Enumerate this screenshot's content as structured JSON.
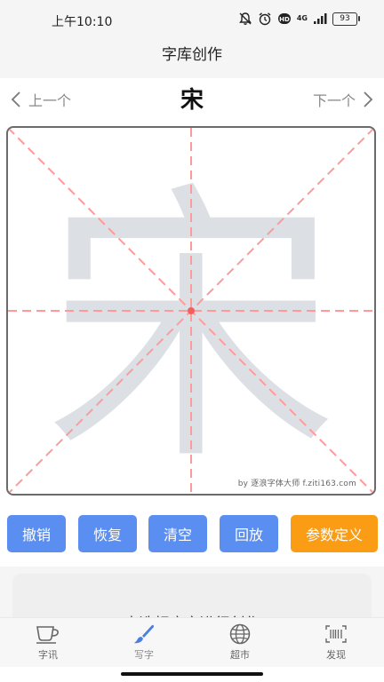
{
  "status": {
    "time": "上午10:10",
    "battery": "93",
    "network": "4G"
  },
  "app": {
    "title": "字库创作"
  },
  "nav": {
    "prev_label": "上一个",
    "next_label": "下一个",
    "current_char": "宋"
  },
  "canvas": {
    "guide_char": "宋",
    "watermark": "by 逐浪字体大师 f.ziti163.com",
    "guide_color": "#ff9a9a"
  },
  "toolbar": {
    "undo": "撤销",
    "redo": "恢复",
    "clear": "清空",
    "playback": "回放",
    "params": "参数定义",
    "colors": {
      "button": "#5a8ef0",
      "primary": "#fa9d14"
    }
  },
  "panel": {
    "text": "点选相应字进行创作"
  },
  "tabbar": {
    "items": [
      {
        "label": "字讯",
        "icon": "coffee-cup-icon"
      },
      {
        "label": "写字",
        "icon": "brush-icon"
      },
      {
        "label": "超市",
        "icon": "globe-icon"
      },
      {
        "label": "发现",
        "icon": "barcode-scan-icon"
      }
    ]
  }
}
